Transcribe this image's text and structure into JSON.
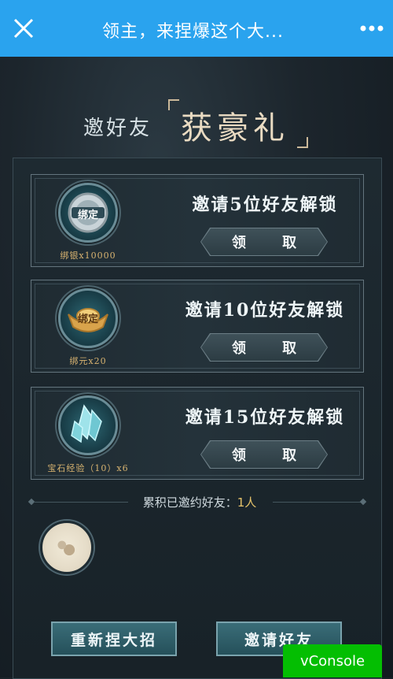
{
  "topbar": {
    "close_icon": "close-icon",
    "title": "领主，来捏爆这个大...",
    "more_icon": "more-icon",
    "color": "#2aa3ee"
  },
  "heading": {
    "small": "邀好友",
    "big": "获豪礼"
  },
  "rewards": [
    {
      "icon": "silver-coin-bound-icon",
      "icon_label": "绑定",
      "reward": "绑银x10000",
      "unlock": "邀请5位好友解锁",
      "claim": "领 取"
    },
    {
      "icon": "gold-ingot-bound-icon",
      "icon_label": "绑定",
      "reward": "绑元x20",
      "unlock": "邀请10位好友解锁",
      "claim": "领 取"
    },
    {
      "icon": "crystal-gem-icon",
      "reward": "宝石经验（10）x6",
      "unlock": "邀请15位好友解锁",
      "claim": "领 取"
    }
  ],
  "summary": {
    "label": "累积已邀约好友：",
    "count": "1人"
  },
  "buttons": {
    "redo": "重新捏大招",
    "invite": "邀请好友"
  },
  "vconsole": "vConsole",
  "colors": {
    "accent_gold": "#e6c36a",
    "reward_text": "#d8b370",
    "panel_bg": "#1e2a31"
  }
}
